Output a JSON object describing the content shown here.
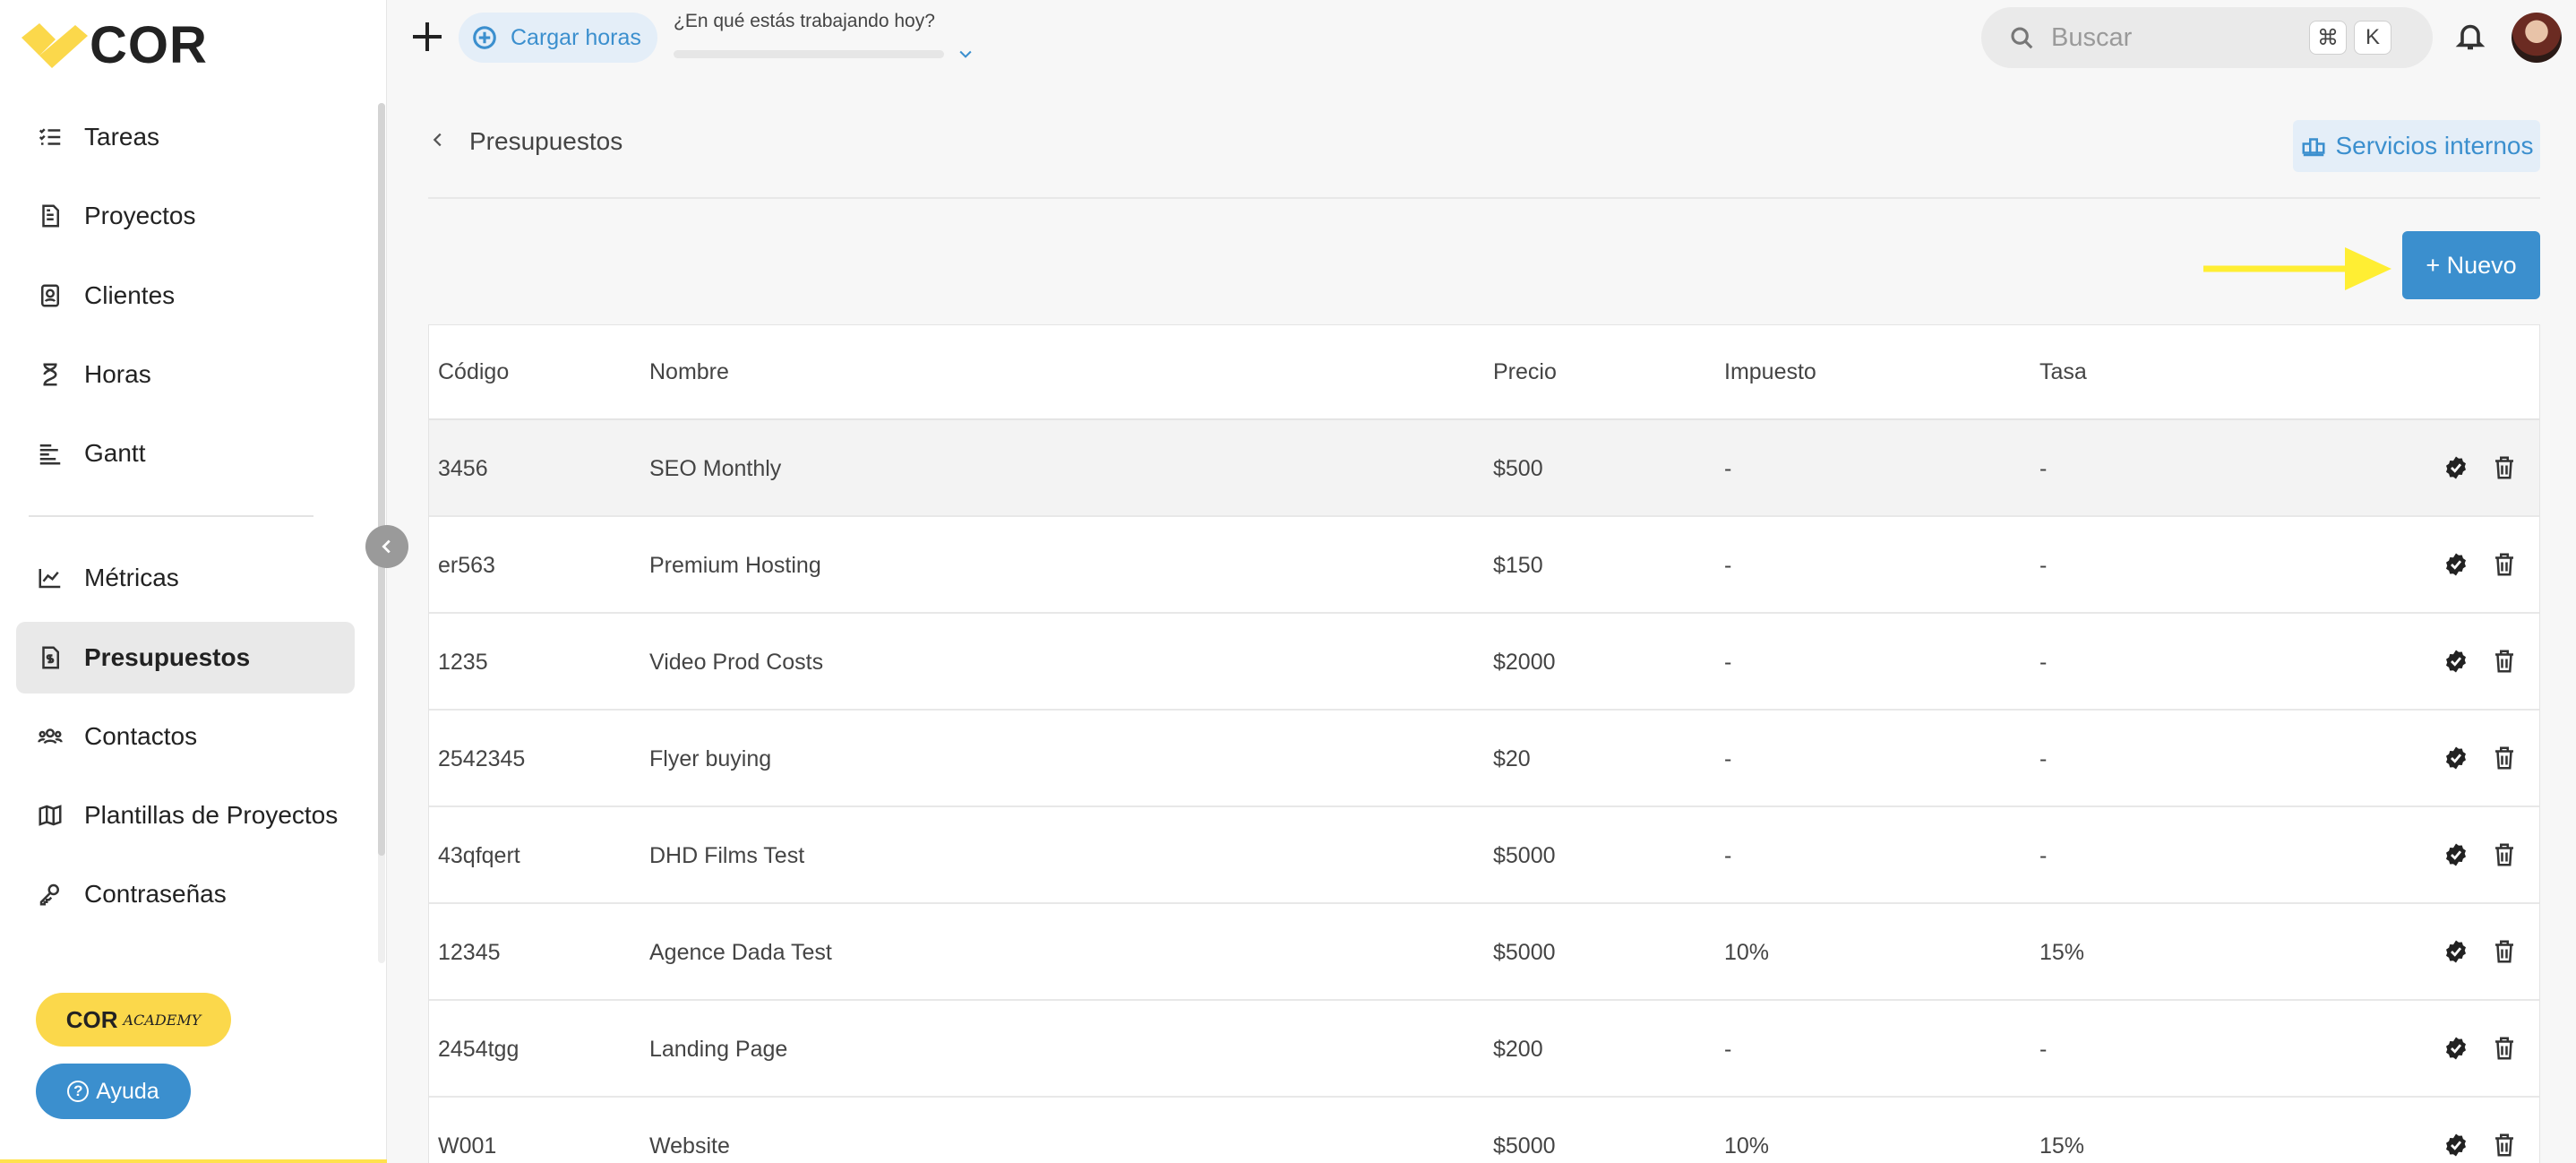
{
  "app": {
    "logo_text": "COR"
  },
  "sidebar": {
    "items": [
      {
        "label": "Tareas",
        "icon": "tasks-icon"
      },
      {
        "label": "Proyectos",
        "icon": "projects-icon"
      },
      {
        "label": "Clientes",
        "icon": "clients-icon"
      },
      {
        "label": "Horas",
        "icon": "hourglass-icon"
      },
      {
        "label": "Gantt",
        "icon": "gantt-icon"
      },
      {
        "label": "Métricas",
        "icon": "metrics-icon"
      },
      {
        "label": "Presupuestos",
        "icon": "budget-icon",
        "active": true
      },
      {
        "label": "Contactos",
        "icon": "contacts-icon"
      },
      {
        "label": "Plantillas de Proyectos",
        "icon": "map-icon"
      },
      {
        "label": "Contraseñas",
        "icon": "key-icon"
      }
    ],
    "academy": {
      "main": "COR",
      "sub": "ACADEMY"
    },
    "help_label": "Ayuda"
  },
  "topbar": {
    "cargar_label": "Cargar horas",
    "working_question": "¿En qué estás trabajando hoy?",
    "search_placeholder": "Buscar",
    "shortcut_keys": [
      "⌘",
      "K"
    ]
  },
  "page": {
    "breadcrumb": "Presupuestos",
    "services_label": "Servicios internos",
    "new_label": "+ Nuevo"
  },
  "table": {
    "columns": [
      "Código",
      "Nombre",
      "Precio",
      "Impuesto",
      "Tasa"
    ],
    "rows": [
      [
        "3456",
        "SEO Monthly",
        "$500",
        "-",
        "-"
      ],
      [
        "er563",
        "Premium Hosting",
        "$150",
        "-",
        "-"
      ],
      [
        "1235",
        "Video Prod Costs",
        "$2000",
        "-",
        "-"
      ],
      [
        "2542345",
        "Flyer buying",
        "$20",
        "-",
        "-"
      ],
      [
        "43qfqert",
        "DHD Films Test",
        "$5000",
        "-",
        "-"
      ],
      [
        "12345",
        "Agence Dada Test",
        "$5000",
        "10%",
        "15%"
      ],
      [
        "2454tgg",
        "Landing Page",
        "$200",
        "-",
        "-"
      ],
      [
        "W001",
        "Website",
        "$5000",
        "10%",
        "15%"
      ]
    ]
  },
  "colors": {
    "accent": "#3b8fce",
    "brand_yellow": "#fbd84b",
    "arrow": "#ffee33"
  }
}
